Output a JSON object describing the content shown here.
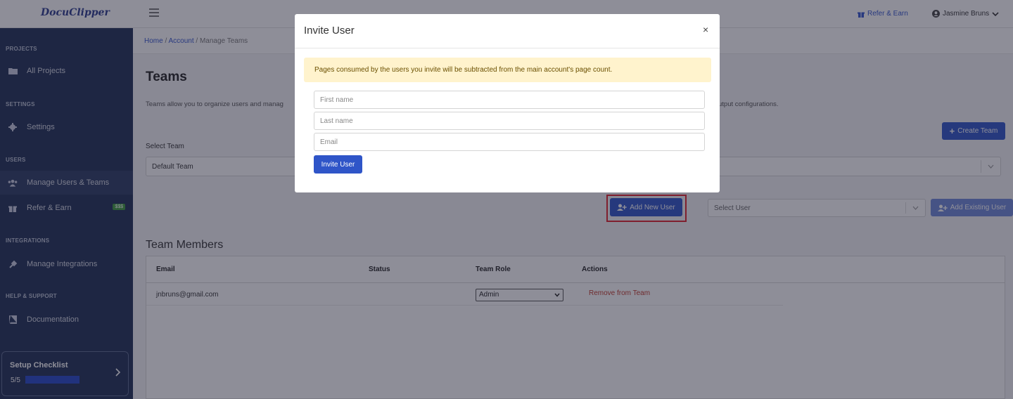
{
  "header": {
    "logo": "DocuClipper",
    "refer_label": "Refer & Earn",
    "user_name": "Jasmine Bruns"
  },
  "sidebar": {
    "sections": [
      {
        "title": "PROJECTS"
      },
      {
        "title": "SETTINGS"
      },
      {
        "title": "USERS"
      },
      {
        "title": "INTEGRATIONS"
      },
      {
        "title": "HELP & SUPPORT"
      }
    ],
    "items": [
      {
        "label": "All Projects",
        "icon": "folder-icon"
      },
      {
        "label": "Settings",
        "icon": "gear-icon"
      },
      {
        "label": "Manage Users & Teams",
        "icon": "users-icon"
      },
      {
        "label": "Refer & Earn",
        "icon": "gift-icon",
        "badge": "$$$"
      },
      {
        "label": "Manage Integrations",
        "icon": "plug-icon"
      },
      {
        "label": "Documentation",
        "icon": "book-icon"
      }
    ],
    "checklist": {
      "title": "Setup Checklist",
      "progress": "5/5"
    }
  },
  "breadcrumb": {
    "home": "Home",
    "account": "Account",
    "current": "Manage Teams"
  },
  "page": {
    "title": "Teams",
    "description_start": "Teams allow you to organize users and manag",
    "description_end": "utput configurations.",
    "create_team": "Create Team",
    "select_team_label": "Select Team",
    "selected_team": "Default Team",
    "add_new_user": "Add New User",
    "select_user_placeholder": "Select User",
    "add_existing_user": "Add Existing User"
  },
  "team_members": {
    "title": "Team Members",
    "columns": [
      "Email",
      "Status",
      "Team Role",
      "Actions"
    ],
    "rows": [
      {
        "email": "jnbruns@gmail.com",
        "status": "",
        "role": "Admin",
        "action": "Remove from Team"
      }
    ]
  },
  "modal": {
    "title": "Invite User",
    "close": "×",
    "alert": "Pages consumed by the users you invite will be subtracted from the main account's page count.",
    "first_name_placeholder": "First name",
    "last_name_placeholder": "Last name",
    "email_placeholder": "Email",
    "invite_button": "Invite User"
  }
}
